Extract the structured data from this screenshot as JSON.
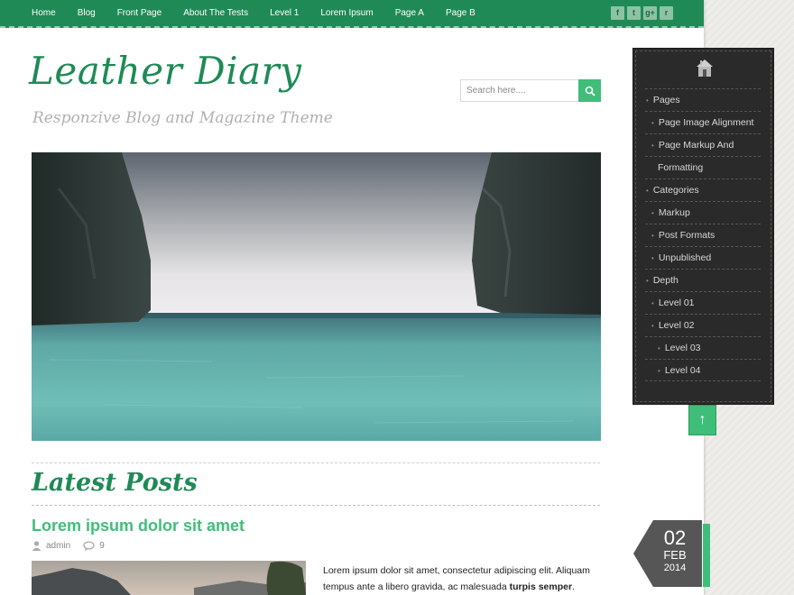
{
  "nav": {
    "items": [
      "Home",
      "Blog",
      "Front Page",
      "About The Tests",
      "Level 1",
      "Lorem Ipsum",
      "Page A",
      "Page B"
    ]
  },
  "social": {
    "icons": [
      "facebook-icon",
      "twitter-icon",
      "google-plus-icon",
      "rss-icon"
    ],
    "glyphs": [
      "f",
      "t",
      "g+",
      "r"
    ]
  },
  "header": {
    "title": "Leather Diary",
    "tagline": "Responzive Blog and Magazine Theme"
  },
  "search": {
    "placeholder": "Search here...."
  },
  "sidebar": {
    "items": [
      {
        "label": "Pages",
        "level": 0
      },
      {
        "label": "Page Image Alignment",
        "level": 1
      },
      {
        "label": "Page Markup And",
        "level": 1
      },
      {
        "label": "Formatting",
        "level": 1,
        "continuation": true
      },
      {
        "label": "Categories",
        "level": 0
      },
      {
        "label": "Markup",
        "level": 1
      },
      {
        "label": "Post Formats",
        "level": 1
      },
      {
        "label": "Unpublished",
        "level": 1
      },
      {
        "label": "Depth",
        "level": 0
      },
      {
        "label": "Level 01",
        "level": 1
      },
      {
        "label": "Level 02",
        "level": 1
      },
      {
        "label": "Level 03",
        "level": 2
      },
      {
        "label": "Level 04",
        "level": 2
      }
    ],
    "scroll_top_label": "↑"
  },
  "main": {
    "section_title": "Latest Posts",
    "post": {
      "title": "Lorem ipsum dolor sit amet",
      "author": "admin",
      "comments": "9",
      "excerpt_start": "Lorem ipsum dolor sit amet, consectetur adipiscing elit. Aliquam tempus ante a libero gravida, ac malesuada ",
      "excerpt_bold": "turpis semper",
      "excerpt_end": ". Sed",
      "date": {
        "day": "02",
        "month": "FEB",
        "year": "2014"
      }
    }
  },
  "colors": {
    "brand": "#1f8a56",
    "accent": "#3fbe7a",
    "sidebar_bg": "#2a2a2a"
  }
}
